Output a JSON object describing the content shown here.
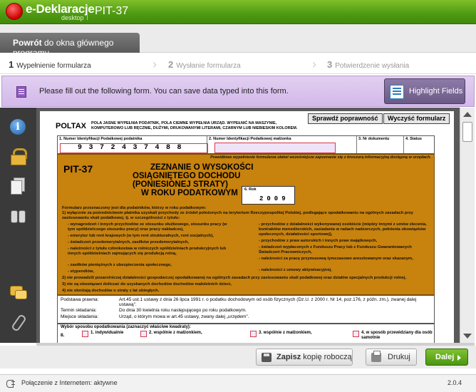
{
  "app": {
    "logo_text": "e-Deklaracje",
    "logo_sub": "desktop",
    "title": "PIT-37"
  },
  "nav": {
    "back_bold": "Powrót",
    "back_rest": " do okna głównego programu"
  },
  "steps": [
    {
      "num": "1",
      "label": "Wypełnienie formularza",
      "active": true
    },
    {
      "num": "2",
      "label": "Wysłanie formularza",
      "active": false
    },
    {
      "num": "3",
      "label": "Potwierdzenie wysłania",
      "active": false
    }
  ],
  "infobar": {
    "message": "Please fill out the following form. You can save data typed into this form.",
    "highlight_label": "Highlight Fields"
  },
  "toolbar_icons": [
    "info-icon",
    "lock-icon",
    "pages-icon",
    "binoculars-icon",
    "comment-icon",
    "attachment-icon"
  ],
  "form": {
    "check_btn": "Sprawdź poprawność",
    "clear_btn": "Wyczyść formularz",
    "poltax": "POLTAX",
    "poltax_note": "POLA JASNE WYPEŁNIA PODATNIK, POLA CIEMNE WYPEŁNIA URZĄD. WYPEŁNIĆ NA MASZYNIE, KOMPUTEROWO LUB RĘCZNIE, DUŻYMI, DRUKOWANYMI LITERAMI, CZARNYM LUB NIEBIESKIM KOLOREM.",
    "field1_label": "1. Numer Identyfikacji Podatkowej podatnika",
    "field1_value": "9372437488",
    "field2_label": "2. Numer Identyfikacji Podatkowej małżonka",
    "field3_label": "3. Nr dokumentu",
    "field4_label": "4. Status",
    "orange_note": "Prawidłowe wypełnienie formularza ułatwi wcześniejsze zapoznanie się z broszurą informacyjną dostępną w urzędach.",
    "pit_label": "PIT-37",
    "title_l1": "ZEZNANIE O WYSOKOŚCI",
    "title_l2": "OSIĄGNIĘTEGO DOCHODU (PONIESIONEJ STRATY)",
    "title_l3": "W ROKU PODATKOWYM",
    "year_label": "6. Rok",
    "year_value": "2009",
    "intro": "Formularz przeznaczony jest dla podatników, którzy w roku podatkowym:",
    "intro_1": "1) wyłącznie za pośrednictwem płatnika uzyskali przychody ze źródeł położonych na terytorium Rzeczypospolitej Polskiej, podlegające opodatkowaniu na ogólnych zasadach przy zastosowaniu skali podatkowej, tj. w szczególności z tytułu:",
    "left_items": [
      "- wynagrodzeń i innych przychodów ze stosunku służbowego, stosunku pracy (w tym spółdzielczego stosunku pracy) oraz pracy nakładczej,",
      "- emerytur lub rent krajowych (w tym rent strukturalnych, rent socjalnych),",
      "- świadczeń przedemerytalnych, zasiłków przedemerytalnych,",
      "- należności z tytułu członkostwa w rolniczych spółdzielniach produkcyjnych lub innych spółdzielniach zajmujących się produkcją rolną,",
      "- zasiłków pieniężnych z ubezpieczenia społecznego,",
      "- stypendiów,"
    ],
    "right_items": [
      "- przychodów z działalności wykonywanej osobiście (między innymi z umów zlecenia, kontraktów menedżerskich, zasiadania w radach nadzorczych, pełnienia obowiązków społecznych, działalności sportowej),",
      "- przychodów z praw autorskich i innych praw majątkowych,",
      "- świadczeń wypłaconych z Funduszu Pracy lub z Funduszu Gwarantowanych Świadczeń Pracowniczych,",
      "- należności za pracę przymusową tymczasowo aresztowanym oraz skazanym,",
      "- należności z umowy aktywizacyjnej,"
    ],
    "intro_2": "2) nie prowadzili pozarolniczej działalności gospodarczej opodatkowanej na ogólnych zasadach przy zastosowaniu skali podatkowej oraz działów specjalnych produkcji rolnej,",
    "intro_3": "3) nie są obowiązani doliczać do uzyskanych dochodów dochodów małoletnich dzieci,",
    "intro_4": "4) nie obniżają dochodów o straty z lat ubiegłych.",
    "legal_k1": "Podstawa prawna:",
    "legal_v1": "Art.45 ust.1 ustawy z dnia 26 lipca 1991 r. o podatku dochodowym od osób fizycznych (Dz.U. z 2000 r. Nr 14, poz.176, z późn. zm.), zwanej dalej ustawą\".",
    "legal_k2": "Termin składania:",
    "legal_v2": "Do dnia 30 kwietnia roku następującego po roku podatkowym.",
    "legal_k3": "Miejsce składania:",
    "legal_v3": "Urząd, o którym mowa w art.45 ustawy, zwany dalej „urzędem\".",
    "sec8_hdr": "Wybór sposobu opodatkowania (zaznaczyć właściwe kwadraty):",
    "sec8_num": "8.",
    "options": [
      "1. indywidualnie",
      "2. wspólnie z małżonkiem,",
      "3. wspólnie z małżonkiem,",
      "4. w sposób przewidziany dla osób samotnie"
    ]
  },
  "actions": {
    "save_bold": "Zapisz",
    "save_rest": " kopię roboczą",
    "print": "Drukuj",
    "next": "Dalej"
  },
  "status": {
    "connection": "Połączenie z Internetem: aktywne",
    "version": "2.0.4"
  },
  "colors": {
    "brand_green": "#4e9a12",
    "info_purple": "#d2b9ea",
    "form_orange": "#c8820e",
    "field_highlight": "#d23b4e"
  }
}
